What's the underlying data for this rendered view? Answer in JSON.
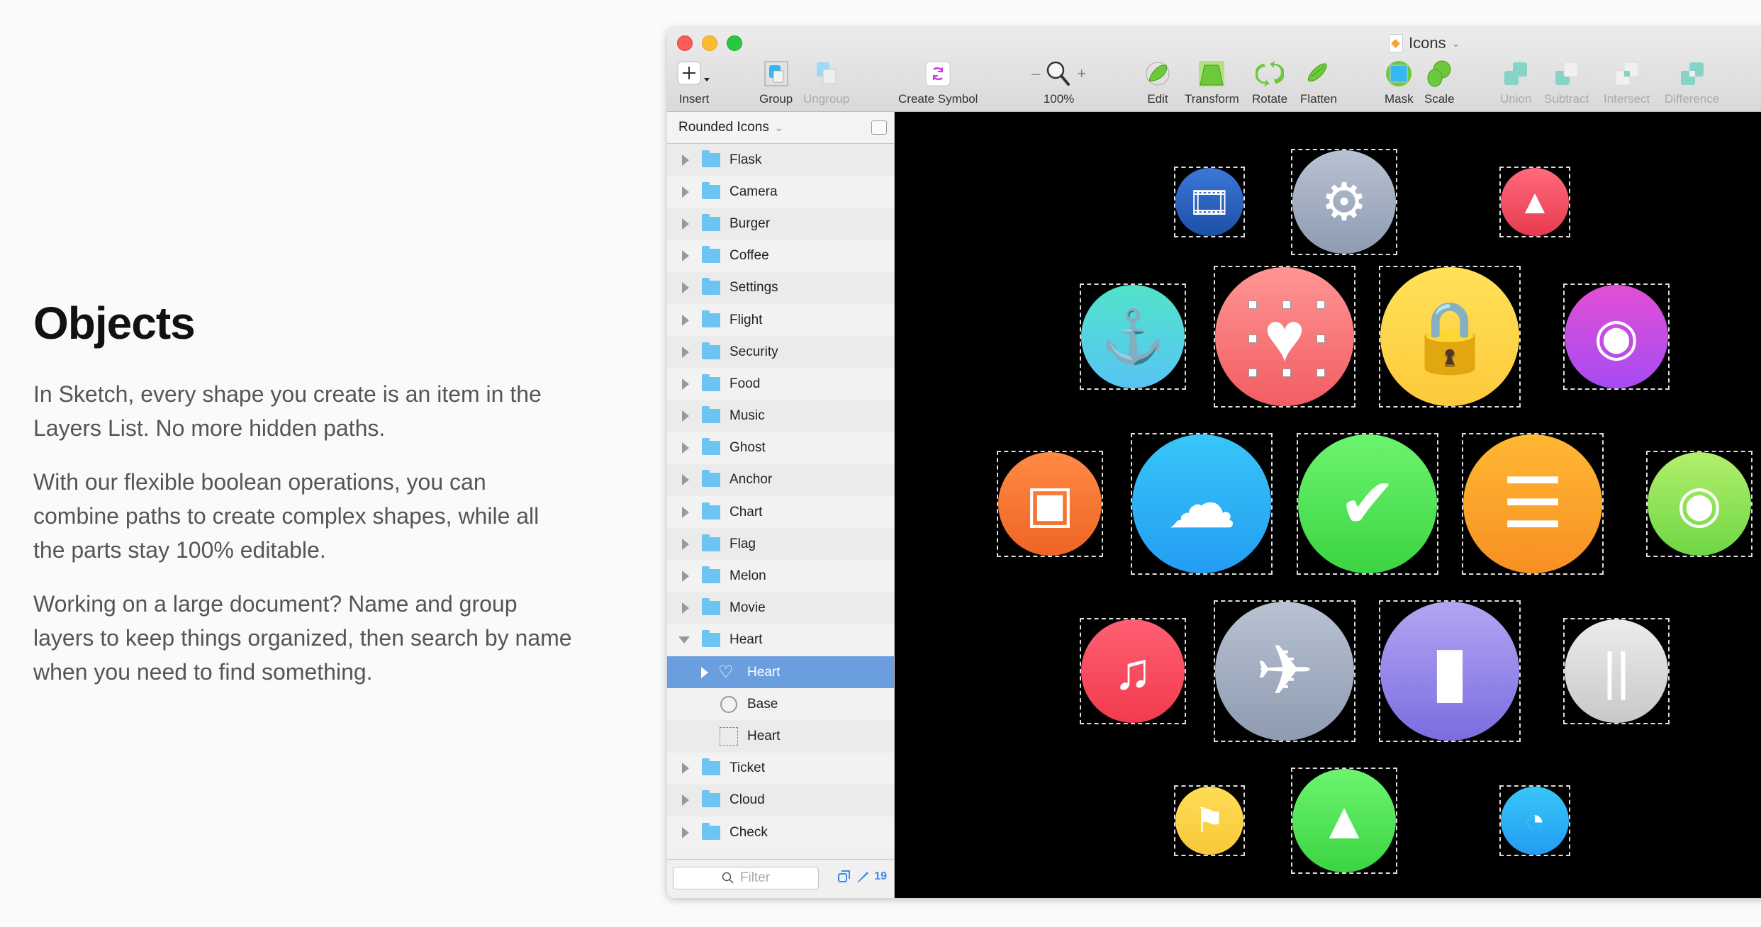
{
  "intro": {
    "title": "Objects",
    "paragraphs": [
      "In Sketch, every shape you create is an item in the Layers List. No more hidden paths.",
      "With our flexible boolean operations, you can combine paths to create complex shapes, while all the parts stay 100% editable.",
      "Working on a large document? Name and group layers to keep things organized, then search by name when you need to find something."
    ]
  },
  "window": {
    "document_title": "Icons",
    "traffic_lights": {
      "close": "#fc5b57",
      "minimize": "#fdbc2f",
      "zoom": "#2ac840"
    }
  },
  "toolbar": {
    "insert": "Insert",
    "group": "Group",
    "ungroup": "Ungroup",
    "create_symbol": "Create Symbol",
    "zoom_minus": "–",
    "zoom_level": "100%",
    "zoom_plus": "+",
    "edit": "Edit",
    "transform": "Transform",
    "rotate": "Rotate",
    "flatten": "Flatten",
    "mask": "Mask",
    "scale": "Scale",
    "union": "Union",
    "subtract": "Subtract",
    "intersect": "Intersect",
    "difference": "Difference"
  },
  "sidebar": {
    "page_name": "Rounded Icons",
    "layers": [
      {
        "name": "Flask",
        "type": "group"
      },
      {
        "name": "Camera",
        "type": "group"
      },
      {
        "name": "Burger",
        "type": "group"
      },
      {
        "name": "Coffee",
        "type": "group"
      },
      {
        "name": "Settings",
        "type": "group"
      },
      {
        "name": "Flight",
        "type": "group"
      },
      {
        "name": "Security",
        "type": "group"
      },
      {
        "name": "Food",
        "type": "group"
      },
      {
        "name": "Music",
        "type": "group"
      },
      {
        "name": "Ghost",
        "type": "group"
      },
      {
        "name": "Anchor",
        "type": "group"
      },
      {
        "name": "Chart",
        "type": "group"
      },
      {
        "name": "Flag",
        "type": "group"
      },
      {
        "name": "Melon",
        "type": "group"
      },
      {
        "name": "Movie",
        "type": "group"
      },
      {
        "name": "Heart",
        "type": "group-expanded"
      },
      {
        "name": "Heart",
        "type": "shape-selected"
      },
      {
        "name": "Base",
        "type": "oval"
      },
      {
        "name": "Heart",
        "type": "path"
      },
      {
        "name": "Ticket",
        "type": "group"
      },
      {
        "name": "Cloud",
        "type": "group"
      },
      {
        "name": "Check",
        "type": "group"
      }
    ],
    "filter_placeholder": "Filter",
    "edited_count": "19"
  },
  "canvas": {
    "icons": [
      {
        "name": "Movie",
        "glyph": "film-icon",
        "colors": [
          "#3a78d8",
          "#1d4fa6"
        ]
      },
      {
        "name": "Settings",
        "glyph": "gear-icon",
        "colors": [
          "#b8c2d2",
          "#8e9bb1"
        ]
      },
      {
        "name": "Melon",
        "glyph": "watermelon-icon",
        "colors": [
          "#ff6b7c",
          "#e83a4e"
        ]
      },
      {
        "name": "Anchor",
        "glyph": "anchor-icon",
        "colors": [
          "#52e3c9",
          "#57c4f5"
        ]
      },
      {
        "name": "Heart",
        "glyph": "heart-icon",
        "colors": [
          "#ff9593",
          "#f25d63"
        ]
      },
      {
        "name": "Security",
        "glyph": "lock-icon",
        "colors": [
          "#ffe259",
          "#fdc93b"
        ]
      },
      {
        "name": "Ghost",
        "glyph": "ghost-icon",
        "colors": [
          "#e24fd6",
          "#a64bf2"
        ]
      },
      {
        "name": "Ticket",
        "glyph": "ticket-icon",
        "colors": [
          "#ff8a45",
          "#ef6424"
        ]
      },
      {
        "name": "Cloud",
        "glyph": "cloud-icon",
        "colors": [
          "#38c6f9",
          "#239df2"
        ]
      },
      {
        "name": "Check",
        "glyph": "check-icon",
        "colors": [
          "#6cf46f",
          "#3bd442"
        ]
      },
      {
        "name": "Burger",
        "glyph": "burger-icon",
        "colors": [
          "#ffb833",
          "#f78f23"
        ]
      },
      {
        "name": "Camera",
        "glyph": "camera-icon",
        "colors": [
          "#b2ef6c",
          "#6fd744"
        ]
      },
      {
        "name": "Music",
        "glyph": "music-icon",
        "colors": [
          "#ff5f73",
          "#f23b4c"
        ]
      },
      {
        "name": "Flight",
        "glyph": "airplane-icon",
        "colors": [
          "#b8c2d2",
          "#8e9bb1"
        ]
      },
      {
        "name": "Coffee",
        "glyph": "coffee-cup-icon",
        "colors": [
          "#b3a5f2",
          "#7a6de0"
        ]
      },
      {
        "name": "Food",
        "glyph": "fork-knife-icon",
        "colors": [
          "#ececec",
          "#c8c8c8"
        ]
      },
      {
        "name": "Flag",
        "glyph": "flag-icon",
        "colors": [
          "#ffdd55",
          "#f9c73a"
        ]
      },
      {
        "name": "Flask",
        "glyph": "flask-icon",
        "colors": [
          "#6cf46f",
          "#3bd442"
        ]
      },
      {
        "name": "Chart",
        "glyph": "pie-chart-icon",
        "colors": [
          "#38c6f9",
          "#239df2"
        ]
      }
    ]
  }
}
